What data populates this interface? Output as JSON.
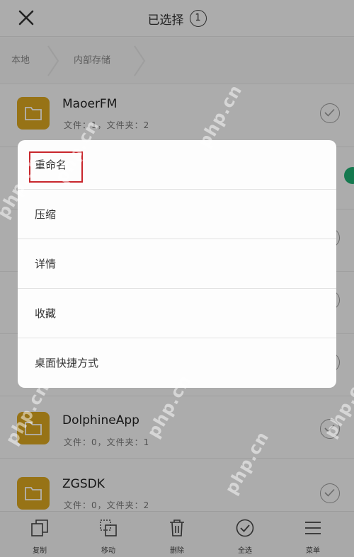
{
  "header": {
    "title": "已选择",
    "selected_count": "1"
  },
  "breadcrumb": {
    "items": [
      "本地",
      "内部存储"
    ]
  },
  "files": [
    {
      "name": "MaoerFM",
      "meta": "文件：1，文件夹：2"
    },
    {
      "name": "DolphineApp",
      "meta": "文件：0，文件夹：1"
    },
    {
      "name": "ZGSDK",
      "meta": "文件：0，文件夹：2"
    }
  ],
  "context_menu": {
    "items": [
      "重命名",
      "压缩",
      "详情",
      "收藏",
      "桌面快捷方式"
    ]
  },
  "toolbar": {
    "copy": "复制",
    "move": "移动",
    "delete": "删除",
    "select_all": "全选",
    "menu": "菜单"
  },
  "watermark": "php.cn",
  "colors": {
    "folder": "#d9a520",
    "highlight": "#c8262c",
    "checked": "#1fae72"
  },
  "icons": [
    "close-icon",
    "folder-icon",
    "checkmark-icon",
    "copy-icon",
    "move-icon",
    "trash-icon",
    "select-all-icon",
    "menu-icon"
  ]
}
